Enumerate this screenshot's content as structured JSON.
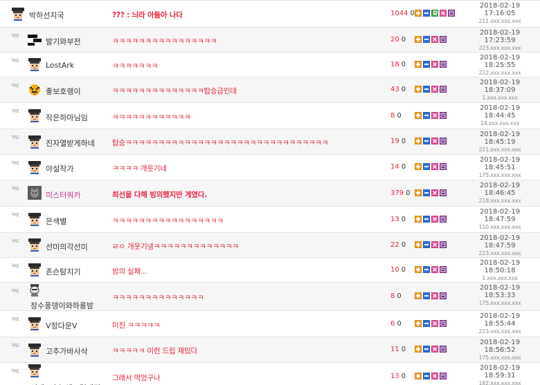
{
  "colors": {
    "message": "#e8243c",
    "nickname_highlight": "#cc3399",
    "row_alt": "#f6f6f6",
    "btn_plus": "#f0a21f",
    "btn_minus": "#2d6fd6",
    "btn_r": "#3aa84a",
    "btn_x": "#e64d9a",
    "btn_edit": "#7a2a8c"
  },
  "reply_marker": "└RE",
  "comments": [
    {
      "reply": false,
      "avatar": "student-cap",
      "nickname": "박하선지국",
      "message": "??? : 늬라 아들아 나다",
      "bold": true,
      "count": "1044",
      "zero": "0",
      "has_r_button": true,
      "date": "2018-02-19",
      "time": "17:16:05",
      "ip": "211.xxx.xxx.xxx"
    },
    {
      "reply": true,
      "avatar": "black-bars",
      "nickname": "발기와부전",
      "message": "ㅋㅋㅋㅋㅋㅋㅋㅋㅋㅋㅋㅋㅋㅋㅋㅋ",
      "bold": false,
      "count": "20",
      "zero": "0",
      "has_r_button": false,
      "date": "2018-02-19",
      "time": "17:23:59",
      "ip": "223.xxx.xxx.xxx"
    },
    {
      "reply": true,
      "avatar": "student-cap",
      "nickname": "LostArk",
      "message": "ㅋㅋㅋㅋㅋㅋㅋ",
      "bold": false,
      "count": "18",
      "zero": "0",
      "has_r_button": false,
      "date": "2018-02-19",
      "time": "18:25:55",
      "ip": "222.xxx.xxx.xxx"
    },
    {
      "reply": true,
      "avatar": "tiger",
      "nickname": "좋보호랭이",
      "message": "ㅋㅋㅋㅋㅋㅋㅋㅋㅋㅋㅋㅋㅋㅋ탑승급인데",
      "bold": false,
      "count": "43",
      "zero": "0",
      "has_r_button": false,
      "date": "2018-02-19",
      "time": "18:37:09",
      "ip": "1.xxx.xxx.xxx"
    },
    {
      "reply": true,
      "avatar": "student-cap",
      "nickname": "작은하마님임",
      "message": "ㅋㅋㅋㅋㅋㅋㅋㅋㅋㅋㅋㅋ",
      "bold": false,
      "count": "8",
      "zero": "0",
      "has_r_button": false,
      "date": "2018-02-19",
      "time": "18:44:45",
      "ip": "14.xxx.xxx.xxx"
    },
    {
      "reply": true,
      "avatar": "student-cap",
      "nickname": "진자열받게하네",
      "message": "탑승ㅋㅋㅋㅋㅋㅋㅋㅋㅋㅋㅋㅋㅋㅋㅋㅋㅋㅋㅋㅋㅋㅋㅋㅋㅋㅋㅋㅋㅋㅋㅋ",
      "bold": false,
      "count": "19",
      "zero": "0",
      "has_r_button": false,
      "date": "2018-02-19",
      "time": "18:45:19",
      "ip": "221.xxx.xxx.xxx"
    },
    {
      "reply": true,
      "avatar": "student-cap",
      "nickname": "야설작가",
      "message": "ㅋㅋㅋㅋ 개웃기네",
      "bold": false,
      "count": "14",
      "zero": "0",
      "has_r_button": false,
      "date": "2018-02-19",
      "time": "18:45:51",
      "ip": "175.xxx.xxx.xxx"
    },
    {
      "reply": true,
      "avatar": "cat-photo",
      "nickname": "미스터쿼카",
      "nickname_highlight": true,
      "message": "최선을 다해 빙의했지만 게였다.",
      "bold": true,
      "count": "379",
      "zero": "0",
      "has_r_button": false,
      "date": "2018-02-19",
      "time": "18:46:45",
      "ip": "218.xxx.xxx.xxx"
    },
    {
      "reply": true,
      "avatar": "student-cap",
      "nickname": "은색별",
      "message": "ㅋㅋㅋㅋㅋㅋㅋㅋㅋㅋㅋㅋㅋㅋㅋㅋㅋ",
      "bold": false,
      "count": "13",
      "zero": "0",
      "has_r_button": false,
      "date": "2018-02-19",
      "time": "18:47:59",
      "ip": "110.xxx.xxx.xxx"
    },
    {
      "reply": true,
      "avatar": "student-cap",
      "nickname": "선미의각선미",
      "message": "ㄹㅇ 개웃기넹ㅋㅋㅋㅋㅋㅋㅋㅋㅋㅋㅋㅋㅋ",
      "bold": false,
      "count": "22",
      "zero": "0",
      "has_r_button": false,
      "date": "2018-02-19",
      "time": "18:47:59",
      "ip": "223.xxx.xxx.xxx"
    },
    {
      "reply": true,
      "avatar": "student-cap",
      "nickname": "존슨탐지기",
      "message": "빙의 실패...",
      "bold": false,
      "count": "10",
      "zero": "0",
      "has_r_button": false,
      "date": "2018-02-19",
      "time": "18:50:18",
      "ip": "1.xxx.xxx.xxx"
    },
    {
      "reply": true,
      "avatar": "sketch-face",
      "nickname": "장수풍뎅이와하롱밤",
      "message": "ㅋㅋㅋㅋㅋㅋㅋㅋㅋㅋㅋㅋㅋㅋ",
      "bold": false,
      "count": "8",
      "zero": "0",
      "has_r_button": false,
      "date": "2018-02-19",
      "time": "18:53:33",
      "ip": "175.xxx.xxx.xxx"
    },
    {
      "reply": true,
      "avatar": "student-cap",
      "nickname": "V정다운V",
      "message": "미친 ㅋㅋㅋㅋㅋ",
      "bold": false,
      "count": "6",
      "zero": "0",
      "has_r_button": false,
      "date": "2018-02-19",
      "time": "18:55:44",
      "ip": "223.xxx.xxx.xxx"
    },
    {
      "reply": true,
      "avatar": "student-cap",
      "nickname": "고추가바사삭",
      "message": "ㅋㅋㅋㅋㅋ 이런 드립 재밌다",
      "bold": false,
      "count": "11",
      "zero": "0",
      "has_r_button": false,
      "date": "2018-02-19",
      "time": "18:56:52",
      "ip": "175.xxx.xxx.xxx"
    },
    {
      "reply": true,
      "avatar": "student-cap",
      "nickname": "이베꼬초능에고렸개리",
      "message": "그래서 먹었구나",
      "bold": false,
      "count": "13",
      "zero": "0",
      "has_r_button": false,
      "date": "2018-02-19",
      "time": "18:59:31",
      "ip": "182.xxx.xxx.xxx"
    }
  ]
}
